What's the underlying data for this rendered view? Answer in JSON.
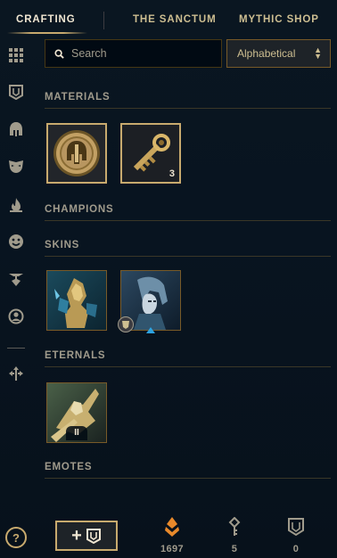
{
  "nav": {
    "tabs": [
      {
        "label": "CRAFTING"
      },
      {
        "label": "THE SANCTUM"
      },
      {
        "label": "MYTHIC SHOP"
      }
    ]
  },
  "rail": {
    "icons": [
      "grid-icon",
      "crest-icon",
      "helmet-icon",
      "mask-icon",
      "flame-icon",
      "emote-face-icon",
      "ward-icon",
      "profile-icon",
      "arrows-icon"
    ],
    "help_label": "?"
  },
  "search": {
    "placeholder": "Search",
    "value": ""
  },
  "sort": {
    "selected": "Alphabetical"
  },
  "sections": {
    "materials": "MATERIALS",
    "champions": "CHAMPIONS",
    "skins": "SKINS",
    "eternals": "ETERNALS",
    "emotes": "EMOTES"
  },
  "materials": [
    {
      "name": "Hextech Chest",
      "icon": "chest-coin-icon",
      "count": ""
    },
    {
      "name": "Hextech Key",
      "icon": "key-icon",
      "count": "3"
    }
  ],
  "skins": [
    {
      "icon": "skin-armor-art"
    },
    {
      "icon": "skin-blue-art"
    }
  ],
  "eternals": [
    {
      "icon": "eternal-art",
      "series": "II"
    }
  ],
  "bottom": {
    "add_icon": "plus-crest-icon",
    "blue_essence": {
      "icon": "essence-icon",
      "value": "1697"
    },
    "keys": {
      "icon": "key-fragment-icon",
      "value": "5"
    },
    "crest": {
      "icon": "crest-icon",
      "value": "0"
    }
  },
  "colors": {
    "gold": "#c8aa6e",
    "gold_light": "#f0e6d2",
    "essence_orange": "#e8892b",
    "background": "#010a13"
  }
}
